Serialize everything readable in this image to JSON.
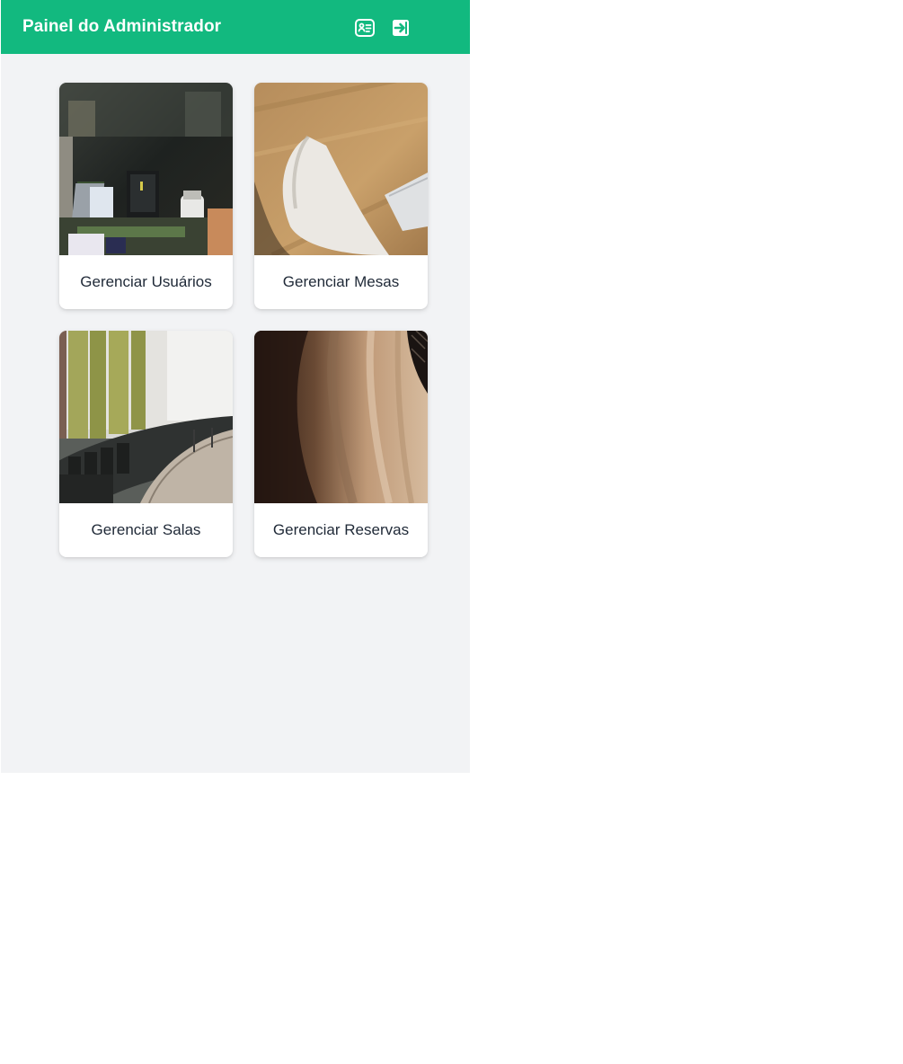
{
  "header": {
    "title": "Painel do Administrador",
    "background_color": "#12b97f",
    "icons": [
      "id-card-icon",
      "logout-icon"
    ]
  },
  "cards": [
    {
      "label": "Gerenciar Usuários",
      "image": "office-workspace-photo"
    },
    {
      "label": "Gerenciar Mesas",
      "image": "wooden-desk-chair-photo"
    },
    {
      "label": "Gerenciar Salas",
      "image": "meeting-room-photo"
    },
    {
      "label": "Gerenciar Reservas",
      "image": "wood-texture-photo"
    }
  ]
}
